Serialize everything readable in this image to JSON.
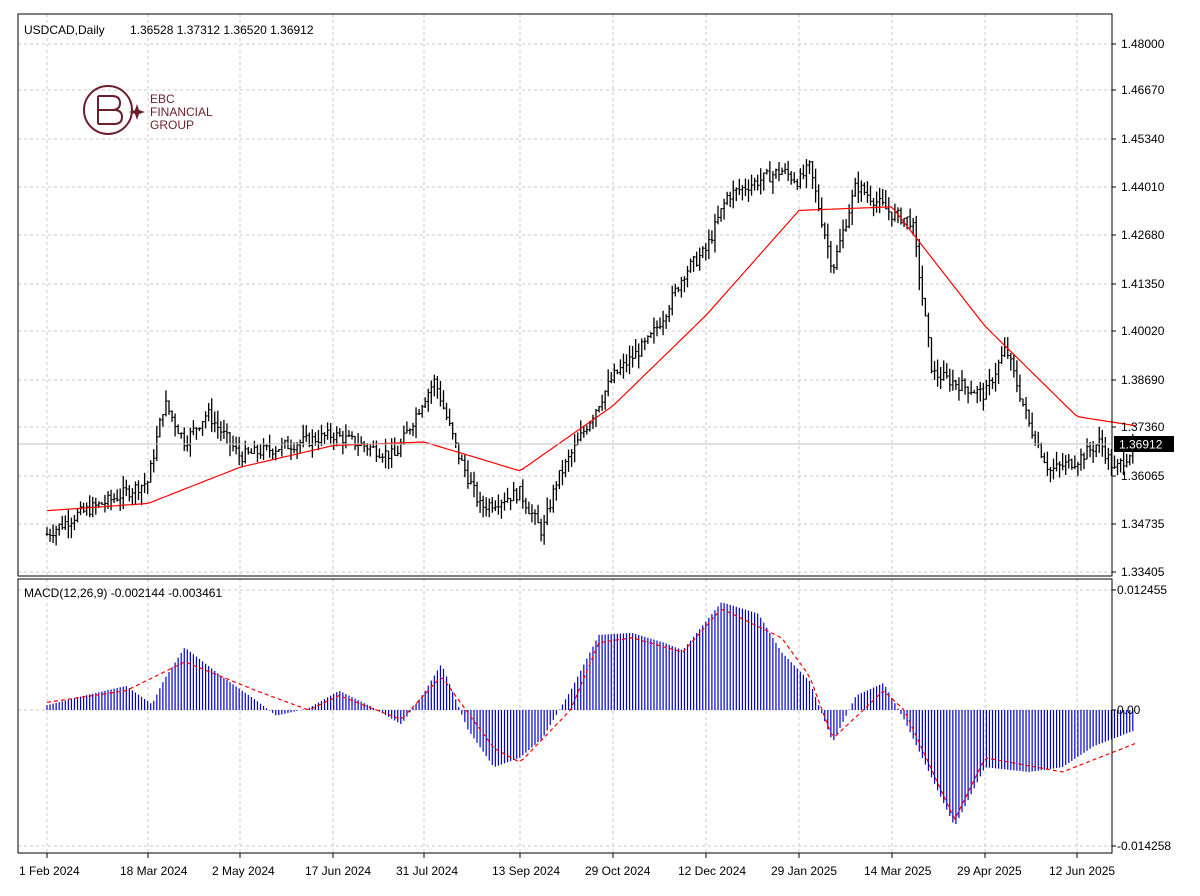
{
  "main_chart": {
    "symbol_label": "USDCAD,Daily",
    "ohlc_text": "1.36528 1.37312 1.36520 1.36912",
    "current_price": "1.36912",
    "logo": {
      "line1": "EBC",
      "line2": "FINANCIAL",
      "line3": "GROUP"
    },
    "y_ticks": [
      "1.48000",
      "1.46670",
      "1.45340",
      "1.44010",
      "1.42680",
      "1.41350",
      "1.40020",
      "1.38690",
      "1.37360",
      "1.36065",
      "1.34735",
      "1.33405"
    ]
  },
  "macd_panel": {
    "label": "MACD(12,26,9) -0.002144 -0.003461",
    "y_ticks": [
      "0.012455",
      "0.00",
      "-0.014258"
    ]
  },
  "x_ticks": [
    "1 Feb 2024",
    "18 Mar 2024",
    "2 May 2024",
    "17 Jun 2024",
    "31 Jul 2024",
    "13 Sep 2024",
    "29 Oct 2024",
    "12 Dec 2024",
    "29 Jan 2025",
    "14 Mar 2025",
    "29 Apr 2025",
    "12 Jun 2025"
  ],
  "colors": {
    "price_bars": "#000000",
    "moving_average": "#ff0000",
    "macd_histogram": "#0000cc",
    "macd_signal": "#ff0000",
    "grid": "#c8c8c8",
    "logo": "#6b1e2b"
  },
  "chart_data": [
    {
      "type": "bar",
      "style": "ohlc",
      "title": "USDCAD,Daily",
      "x_range": [
        "1 Feb 2024",
        "end Jun 2025"
      ],
      "ylim": [
        1.33405,
        1.48
      ],
      "current": 1.36912,
      "grid": true,
      "series": [
        {
          "kind": "price_close_path",
          "points": [
            [
              "1 Feb 2024",
              1.3445
            ],
            [
              "15 Feb 2024",
              1.35
            ],
            [
              "1 Mar 2024",
              1.354
            ],
            [
              "18 Mar 2024",
              1.359
            ],
            [
              "26 Mar 2024",
              1.381
            ],
            [
              "5 Apr 2024",
              1.37
            ],
            [
              "16 Apr 2024",
              1.378
            ],
            [
              "2 May 2024",
              1.366
            ],
            [
              "17 Jun 2024",
              1.372
            ],
            [
              "2 Jul 2024",
              1.369
            ],
            [
              "17 Jul 2024",
              1.366
            ],
            [
              "31 Jul 2024",
              1.382
            ],
            [
              "5 Aug 2024",
              1.387
            ],
            [
              "16 Aug 2024",
              1.366
            ],
            [
              "26 Aug 2024",
              1.352
            ],
            [
              "13 Sep 2024",
              1.356
            ],
            [
              "24 Sep 2024",
              1.345
            ],
            [
              "1 Oct 2024",
              1.359
            ],
            [
              "29 Oct 2024",
              1.388
            ],
            [
              "15 Nov 2024",
              1.398
            ],
            [
              "22 Nov 2024",
              1.405
            ],
            [
              "2 Dec 2024",
              1.417
            ],
            [
              "12 Dec 2024",
              1.423
            ],
            [
              "23 Dec 2024",
              1.438
            ],
            [
              "3 Jan 2025",
              1.441
            ],
            [
              "20 Jan 2025",
              1.445
            ],
            [
              "29 Jan 2025",
              1.442
            ],
            [
              "3 Feb 2025",
              1.446
            ],
            [
              "14 Feb 2025",
              1.418
            ],
            [
              "25 Feb 2025",
              1.441
            ],
            [
              "14 Mar 2025",
              1.433
            ],
            [
              "24 Mar 2025",
              1.431
            ],
            [
              "3 Apr 2025",
              1.389
            ],
            [
              "29 Apr 2025",
              1.383
            ],
            [
              "9 May 2025",
              1.396
            ],
            [
              "20 May 2025",
              1.375
            ],
            [
              "30 May 2025",
              1.362
            ],
            [
              "12 Jun 2025",
              1.365
            ],
            [
              "23 Jun 2025",
              1.37
            ],
            [
              "30 Jun 2025",
              1.362
            ],
            [
              "10 Jul 2025",
              1.3691
            ]
          ]
        },
        {
          "kind": "moving_average",
          "points": [
            [
              "1 Feb 2024",
              1.351
            ],
            [
              "18 Mar 2024",
              1.353
            ],
            [
              "2 May 2024",
              1.363
            ],
            [
              "17 Jun 2024",
              1.369
            ],
            [
              "31 Jul 2024",
              1.37
            ],
            [
              "13 Sep 2024",
              1.362
            ],
            [
              "29 Oct 2024",
              1.38
            ],
            [
              "12 Dec 2024",
              1.405
            ],
            [
              "29 Jan 2025",
              1.434
            ],
            [
              "14 Mar 2025",
              1.435
            ],
            [
              "29 Apr 2025",
              1.402
            ],
            [
              "12 Jun 2025",
              1.377
            ],
            [
              "10 Jul 2025",
              1.3745
            ]
          ]
        }
      ]
    },
    {
      "type": "bar",
      "title": "MACD(12,26,9)",
      "ylim": [
        -0.014258,
        0.012455
      ],
      "macd": -0.002144,
      "signal": -0.003461,
      "series": [
        {
          "name": "MACD",
          "points": [
            [
              "1 Feb 2024",
              0.0005
            ],
            [
              "20 Feb 2024",
              0.0016
            ],
            [
              "8 Mar 2024",
              0.0025
            ],
            [
              "20 Mar 2024",
              0.0006
            ],
            [
              "26 Mar 2024",
              0.0032
            ],
            [
              "5 Apr 2024",
              0.0065
            ],
            [
              "23 Apr 2024",
              0.0035
            ],
            [
              "10 May 2024",
              0.001
            ],
            [
              "20 May 2024",
              -0.0006
            ],
            [
              "5 Jun 2024",
              0.0002
            ],
            [
              "20 Jun 2024",
              0.002
            ],
            [
              "5 Jul 2024",
              0.0004
            ],
            [
              "20 Jul 2024",
              -0.0015
            ],
            [
              "31 Jul 2024",
              0.0018
            ],
            [
              "8 Aug 2024",
              0.0048
            ],
            [
              "20 Aug 2024",
              -0.002
            ],
            [
              "1 Sep 2024",
              -0.006
            ],
            [
              "13 Sep 2024",
              -0.005
            ],
            [
              "24 Sep 2024",
              -0.003
            ],
            [
              "8 Oct 2024",
              0.002
            ],
            [
              "22 Oct 2024",
              0.0078
            ],
            [
              "7 Nov 2024",
              0.008
            ],
            [
              "22 Nov 2024",
              0.007
            ],
            [
              "1 Dec 2024",
              0.0062
            ],
            [
              "20 Dec 2024",
              0.0112
            ],
            [
              "8 Jan 2025",
              0.01
            ],
            [
              "20 Jan 2025",
              0.006
            ],
            [
              "3 Feb 2025",
              0.003
            ],
            [
              "14 Feb 2025",
              -0.0034
            ],
            [
              "25 Feb 2025",
              0.0015
            ],
            [
              "10 Mar 2025",
              0.0028
            ],
            [
              "20 Mar 2025",
              -0.001
            ],
            [
              "14 Apr 2025",
              -0.0122
            ],
            [
              "29 Apr 2025",
              -0.006
            ],
            [
              "20 May 2025",
              -0.0065
            ],
            [
              "5 Jun 2025",
              -0.006
            ],
            [
              "20 Jun 2025",
              -0.0038
            ],
            [
              "10 Jul 2025",
              -0.0021
            ]
          ]
        },
        {
          "name": "Signal",
          "points": [
            [
              "1 Feb 2024",
              0.0008
            ],
            [
              "8 Mar 2024",
              0.002
            ],
            [
              "5 Apr 2024",
              0.005
            ],
            [
              "10 May 2024",
              0.002
            ],
            [
              "5 Jun 2024",
              0.0
            ],
            [
              "20 Jun 2024",
              0.0015
            ],
            [
              "20 Jul 2024",
              -0.001
            ],
            [
              "8 Aug 2024",
              0.0035
            ],
            [
              "1 Sep 2024",
              -0.004
            ],
            [
              "13 Sep 2024",
              -0.0055
            ],
            [
              "8 Oct 2024",
              0.0
            ],
            [
              "22 Oct 2024",
              0.007
            ],
            [
              "7 Nov 2024",
              0.0075
            ],
            [
              "1 Dec 2024",
              0.006
            ],
            [
              "20 Dec 2024",
              0.0105
            ],
            [
              "20 Jan 2025",
              0.0075
            ],
            [
              "3 Feb 2025",
              0.0035
            ],
            [
              "14 Feb 2025",
              -0.003
            ],
            [
              "10 Mar 2025",
              0.002
            ],
            [
              "20 Mar 2025",
              0.0
            ],
            [
              "14 Apr 2025",
              -0.0115
            ],
            [
              "29 Apr 2025",
              -0.005
            ],
            [
              "5 Jun 2025",
              -0.0065
            ],
            [
              "10 Jul 2025",
              -0.0035
            ]
          ]
        }
      ]
    }
  ]
}
